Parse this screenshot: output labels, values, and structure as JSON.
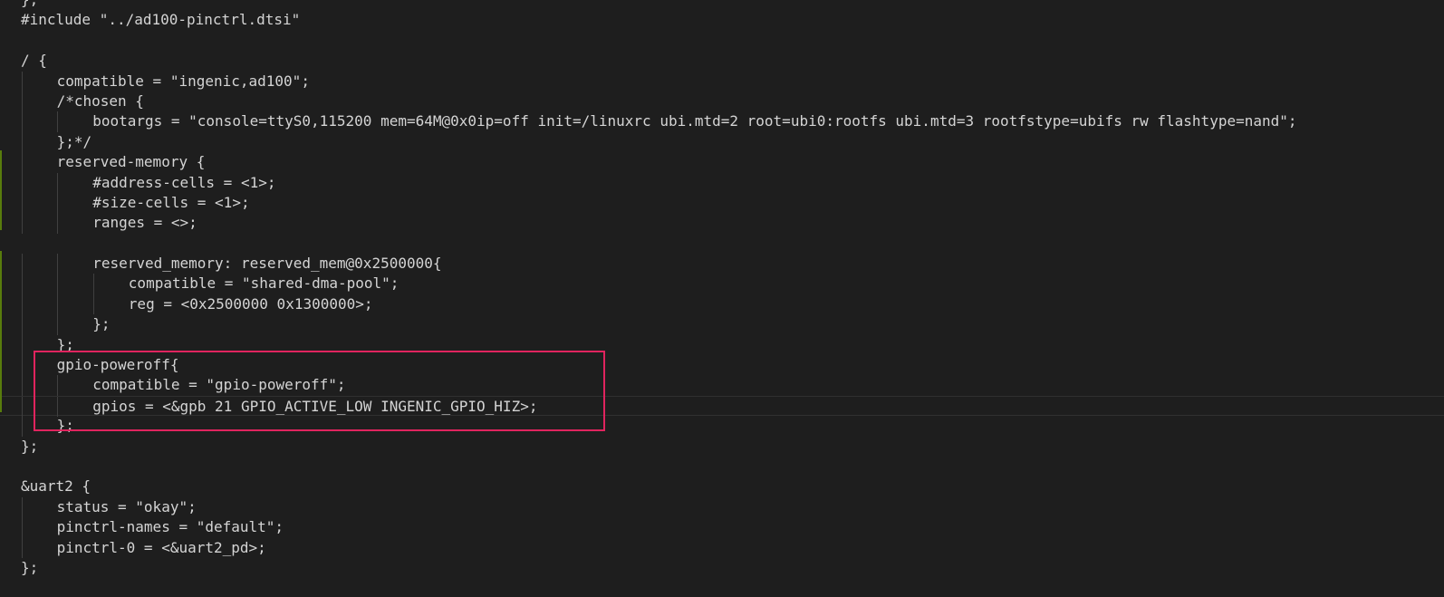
{
  "editor": {
    "lines": [
      {
        "text": "};",
        "indent": 0
      },
      {
        "text": "#include \"../ad100-pinctrl.dtsi\"",
        "indent": 0
      },
      {
        "text": "",
        "indent": 0
      },
      {
        "text": "/ {",
        "indent": 0
      },
      {
        "text": "compatible = \"ingenic,ad100\";",
        "indent": 1
      },
      {
        "text": "/*chosen {",
        "indent": 1
      },
      {
        "text": "bootargs = \"console=ttyS0,115200 mem=64M@0x0ip=off init=/linuxrc ubi.mtd=2 root=ubi0:rootfs ubi.mtd=3 rootfstype=ubifs rw flashtype=nand\";",
        "indent": 2
      },
      {
        "text": "};*/",
        "indent": 1
      },
      {
        "text": "reserved-memory {",
        "indent": 1
      },
      {
        "text": "#address-cells = <1>;",
        "indent": 2
      },
      {
        "text": "#size-cells = <1>;",
        "indent": 2
      },
      {
        "text": "ranges = <>;",
        "indent": 2
      },
      {
        "text": "",
        "indent": 0
      },
      {
        "text": "reserved_memory: reserved_mem@0x2500000{",
        "indent": 2
      },
      {
        "text": "compatible = \"shared-dma-pool\";",
        "indent": 3
      },
      {
        "text": "reg = <0x2500000 0x1300000>;",
        "indent": 3
      },
      {
        "text": "};",
        "indent": 2
      },
      {
        "text": "};",
        "indent": 1
      },
      {
        "text": "gpio-poweroff{",
        "indent": 1
      },
      {
        "text": "compatible = \"gpio-poweroff\";",
        "indent": 2
      },
      {
        "text": "gpios = <&gpb 21 GPIO_ACTIVE_LOW INGENIC_GPIO_HIZ>;",
        "indent": 2,
        "current": true
      },
      {
        "text": "};",
        "indent": 1
      },
      {
        "text": "};",
        "indent": 0
      },
      {
        "text": "",
        "indent": 0
      },
      {
        "text": "&uart2 {",
        "indent": 0
      },
      {
        "text": "status = \"okay\";",
        "indent": 1
      },
      {
        "text": "pinctrl-names = \"default\";",
        "indent": 1
      },
      {
        "text": "pinctrl-0 = <&uart2_pd>;",
        "indent": 1
      },
      {
        "text": "};",
        "indent": 0
      }
    ]
  },
  "colors": {
    "background": "#1e1e1e",
    "text": "#d4d4d4",
    "indent_guide": "#404040",
    "gutter_modified": "#587c0c",
    "highlight_box": "#e0245e"
  }
}
